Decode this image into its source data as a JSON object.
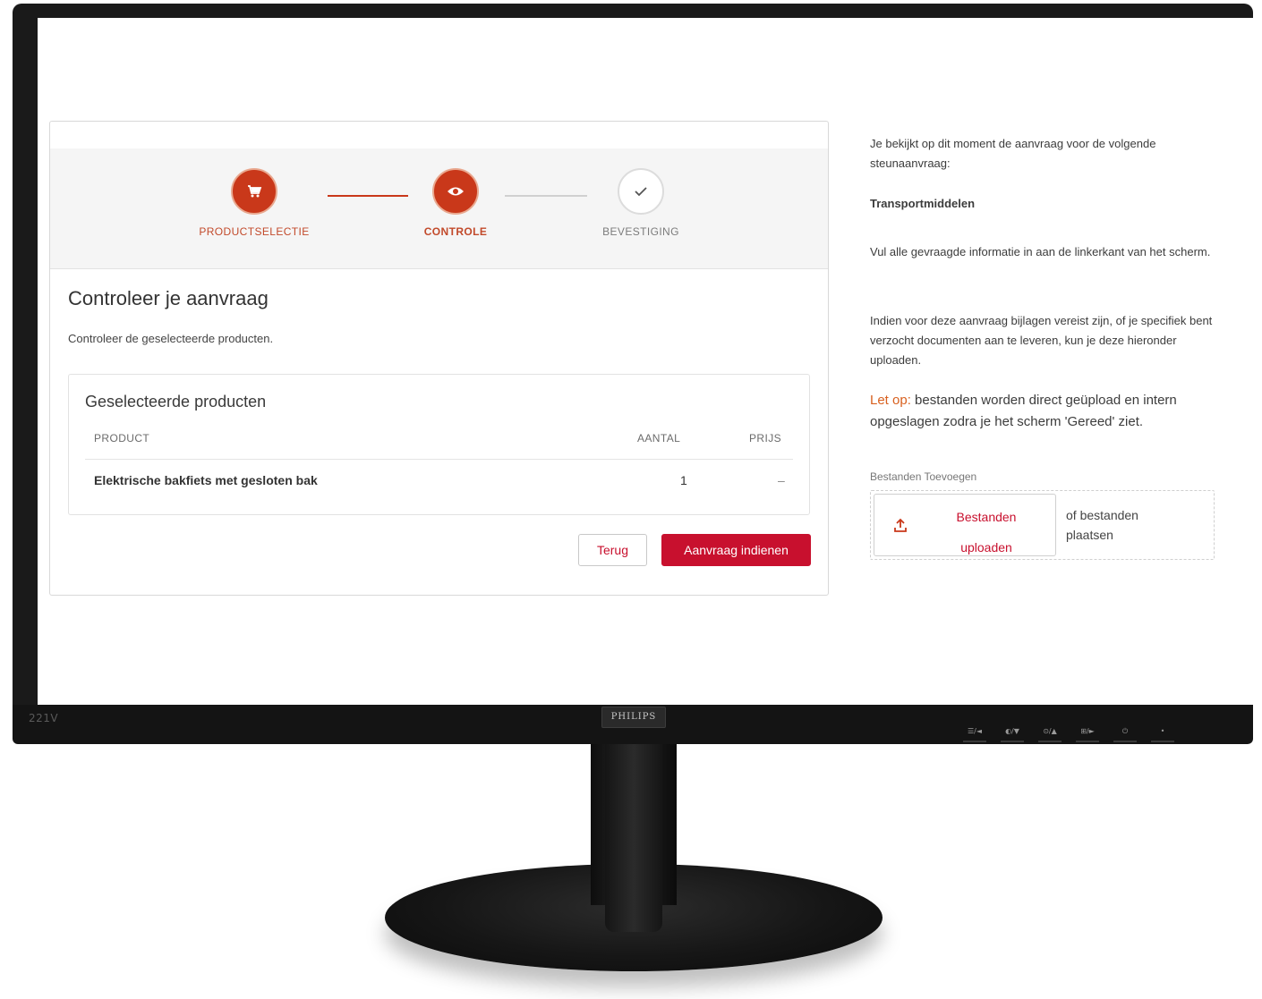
{
  "monitor": {
    "model": "221V",
    "brand": "PHILIPS",
    "controls": [
      "☰/◄",
      "◐/▼",
      "⊙/▲",
      "⊞/►",
      "⏻",
      "•"
    ]
  },
  "stepper": {
    "steps": [
      {
        "label": "PRODUCTSELECTIE",
        "icon": "cart-icon",
        "state": "done"
      },
      {
        "label": "CONTROLE",
        "icon": "eye-icon",
        "state": "active"
      },
      {
        "label": "BEVESTIGING",
        "icon": "check-icon",
        "state": "todo"
      }
    ]
  },
  "main": {
    "title": "Controleer je aanvraag",
    "subtitle": "Controleer de geselecteerde producten.",
    "products": {
      "heading": "Geselecteerde producten",
      "columns": [
        "PRODUCT",
        "AANTAL",
        "PRIJS"
      ],
      "rows": [
        {
          "product": "Elektrische bakfiets met gesloten bak",
          "aantal": "1",
          "prijs": "–"
        }
      ]
    },
    "back_label": "Terug",
    "submit_label": "Aanvraag indienen"
  },
  "sidebar": {
    "intro": "Je bekijkt op dit moment de aanvraag voor de volgende steunaanvraag:",
    "category": "Transportmiddelen",
    "instruction": "Vul alle gevraagde informatie in aan de linkerkant van het scherm.",
    "attachments_info": "Indien voor deze aanvraag bijlagen vereist zijn, of je specifiek bent verzocht documenten aan te leveren, kun je deze hieronder uploaden.",
    "warning_prefix": "Let op:",
    "warning_text": " bestanden worden direct geüpload en intern opgeslagen zodra je het scherm 'Gereed' ziet.",
    "upload": {
      "label": "Bestanden Toevoegen",
      "button_label": "Bestanden uploaden",
      "drop_text": "of bestanden plaatsen"
    }
  },
  "colors": {
    "accent": "#c9381a",
    "primary_button": "#c8102e",
    "warning": "#d8601f"
  }
}
